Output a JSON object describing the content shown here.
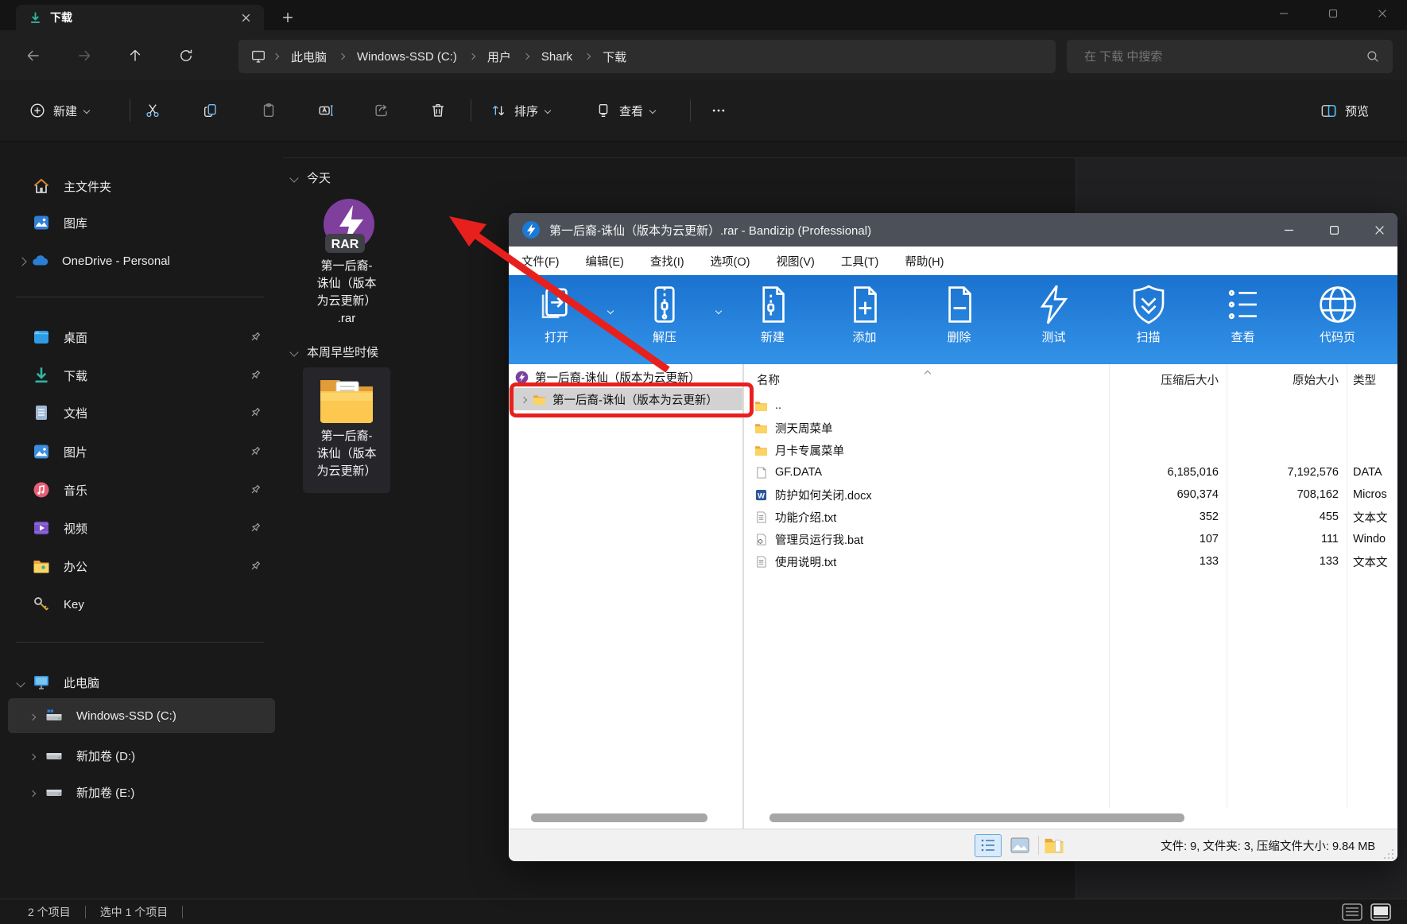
{
  "colors": {
    "explorer_bg": "#191919",
    "chrome_bg": "#1f1f1f",
    "field_bg": "#2d2d2d",
    "accent_blue": "#4cc2ff",
    "download_teal": "#2fb8a6",
    "folder_yellow": "#fcd462",
    "rar_purple": "#7e3f9d",
    "bandizip_titlebar": "#4c5058",
    "bandizip_toolbar_top": "#1a72cf",
    "bandizip_toolbar_bottom": "#3392e8",
    "annotation_red": "#e8201d",
    "selection_gray": "#d2d2d2"
  },
  "explorer": {
    "tab": {
      "title": "下载"
    },
    "breadcrumb": {
      "items": [
        "此电脑",
        "Windows-SSD (C:)",
        "用户",
        "Shark",
        "下载"
      ]
    },
    "search": {
      "placeholder": "在 下载 中搜索"
    },
    "commandbar": {
      "new_label": "新建",
      "sort_label": "排序",
      "view_label": "查看",
      "preview_label": "预览"
    },
    "sidebar": {
      "items": [
        {
          "label": "主文件夹"
        },
        {
          "label": "图库"
        },
        {
          "label": "OneDrive - Personal"
        },
        {
          "label": "桌面"
        },
        {
          "label": "下载"
        },
        {
          "label": "文档"
        },
        {
          "label": "图片"
        },
        {
          "label": "音乐"
        },
        {
          "label": "视频"
        },
        {
          "label": "办公"
        },
        {
          "label": "Key"
        },
        {
          "label": "此电脑"
        },
        {
          "label": "Windows-SSD (C:)"
        },
        {
          "label": "新加卷 (D:)"
        },
        {
          "label": "新加卷 (E:)"
        }
      ]
    },
    "content": {
      "group_today": "今天",
      "group_earlier": "本周早些时候",
      "rar_badge": "RAR",
      "rar_name": "第一后裔-\n诛仙（版本\n为云更新）\n.rar",
      "folder_name": "第一后裔-\n诛仙（版本\n为云更新）"
    },
    "statusbar": {
      "count": "2 个项目",
      "selected": "选中 1 个项目"
    }
  },
  "bandizip": {
    "title": "第一后裔-诛仙（版本为云更新）.rar - Bandizip (Professional)",
    "menu": [
      "文件(F)",
      "编辑(E)",
      "查找(I)",
      "选项(O)",
      "视图(V)",
      "工具(T)",
      "帮助(H)"
    ],
    "toolbar": [
      "打开",
      "解压",
      "新建",
      "添加",
      "删除",
      "测试",
      "扫描",
      "查看",
      "代码页"
    ],
    "tree": {
      "root": "第一后裔-诛仙（版本为云更新）",
      "child": "第一后裔-诛仙（版本为云更新）"
    },
    "columns": [
      "名称",
      "压缩后大小",
      "原始大小",
      "类型"
    ],
    "rows": [
      {
        "name": "..",
        "compressed": "",
        "original": "",
        "type": ""
      },
      {
        "name": "测天周菜单",
        "compressed": "",
        "original": "",
        "type": ""
      },
      {
        "name": "月卡专属菜单",
        "compressed": "",
        "original": "",
        "type": ""
      },
      {
        "name": "GF.DATA",
        "compressed": "6,185,016",
        "original": "7,192,576",
        "type": "DATA"
      },
      {
        "name": "防护如何关闭.docx",
        "compressed": "690,374",
        "original": "708,162",
        "type": "Micros"
      },
      {
        "name": "功能介绍.txt",
        "compressed": "352",
        "original": "455",
        "type": "文本文"
      },
      {
        "name": "管理员运行我.bat",
        "compressed": "107",
        "original": "111",
        "type": "Windo"
      },
      {
        "name": "使用说明.txt",
        "compressed": "133",
        "original": "133",
        "type": "文本文"
      }
    ],
    "statusbar": {
      "summary": "文件: 9, 文件夹: 3, 压缩文件大小: 9.84 MB"
    }
  }
}
